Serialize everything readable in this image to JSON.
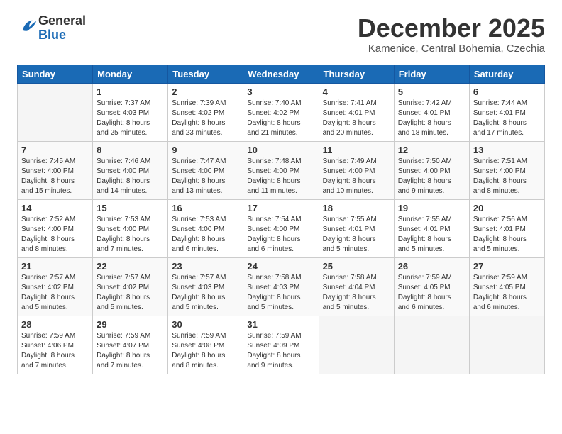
{
  "header": {
    "logo": {
      "general": "General",
      "blue": "Blue"
    },
    "title": "December 2025",
    "location": "Kamenice, Central Bohemia, Czechia"
  },
  "weekdays": [
    "Sunday",
    "Monday",
    "Tuesday",
    "Wednesday",
    "Thursday",
    "Friday",
    "Saturday"
  ],
  "weeks": [
    [
      {
        "day": "",
        "info": ""
      },
      {
        "day": "1",
        "info": "Sunrise: 7:37 AM\nSunset: 4:03 PM\nDaylight: 8 hours\nand 25 minutes."
      },
      {
        "day": "2",
        "info": "Sunrise: 7:39 AM\nSunset: 4:02 PM\nDaylight: 8 hours\nand 23 minutes."
      },
      {
        "day": "3",
        "info": "Sunrise: 7:40 AM\nSunset: 4:02 PM\nDaylight: 8 hours\nand 21 minutes."
      },
      {
        "day": "4",
        "info": "Sunrise: 7:41 AM\nSunset: 4:01 PM\nDaylight: 8 hours\nand 20 minutes."
      },
      {
        "day": "5",
        "info": "Sunrise: 7:42 AM\nSunset: 4:01 PM\nDaylight: 8 hours\nand 18 minutes."
      },
      {
        "day": "6",
        "info": "Sunrise: 7:44 AM\nSunset: 4:01 PM\nDaylight: 8 hours\nand 17 minutes."
      }
    ],
    [
      {
        "day": "7",
        "info": "Sunrise: 7:45 AM\nSunset: 4:00 PM\nDaylight: 8 hours\nand 15 minutes."
      },
      {
        "day": "8",
        "info": "Sunrise: 7:46 AM\nSunset: 4:00 PM\nDaylight: 8 hours\nand 14 minutes."
      },
      {
        "day": "9",
        "info": "Sunrise: 7:47 AM\nSunset: 4:00 PM\nDaylight: 8 hours\nand 13 minutes."
      },
      {
        "day": "10",
        "info": "Sunrise: 7:48 AM\nSunset: 4:00 PM\nDaylight: 8 hours\nand 11 minutes."
      },
      {
        "day": "11",
        "info": "Sunrise: 7:49 AM\nSunset: 4:00 PM\nDaylight: 8 hours\nand 10 minutes."
      },
      {
        "day": "12",
        "info": "Sunrise: 7:50 AM\nSunset: 4:00 PM\nDaylight: 8 hours\nand 9 minutes."
      },
      {
        "day": "13",
        "info": "Sunrise: 7:51 AM\nSunset: 4:00 PM\nDaylight: 8 hours\nand 8 minutes."
      }
    ],
    [
      {
        "day": "14",
        "info": "Sunrise: 7:52 AM\nSunset: 4:00 PM\nDaylight: 8 hours\nand 8 minutes."
      },
      {
        "day": "15",
        "info": "Sunrise: 7:53 AM\nSunset: 4:00 PM\nDaylight: 8 hours\nand 7 minutes."
      },
      {
        "day": "16",
        "info": "Sunrise: 7:53 AM\nSunset: 4:00 PM\nDaylight: 8 hours\nand 6 minutes."
      },
      {
        "day": "17",
        "info": "Sunrise: 7:54 AM\nSunset: 4:00 PM\nDaylight: 8 hours\nand 6 minutes."
      },
      {
        "day": "18",
        "info": "Sunrise: 7:55 AM\nSunset: 4:01 PM\nDaylight: 8 hours\nand 5 minutes."
      },
      {
        "day": "19",
        "info": "Sunrise: 7:55 AM\nSunset: 4:01 PM\nDaylight: 8 hours\nand 5 minutes."
      },
      {
        "day": "20",
        "info": "Sunrise: 7:56 AM\nSunset: 4:01 PM\nDaylight: 8 hours\nand 5 minutes."
      }
    ],
    [
      {
        "day": "21",
        "info": "Sunrise: 7:57 AM\nSunset: 4:02 PM\nDaylight: 8 hours\nand 5 minutes."
      },
      {
        "day": "22",
        "info": "Sunrise: 7:57 AM\nSunset: 4:02 PM\nDaylight: 8 hours\nand 5 minutes."
      },
      {
        "day": "23",
        "info": "Sunrise: 7:57 AM\nSunset: 4:03 PM\nDaylight: 8 hours\nand 5 minutes."
      },
      {
        "day": "24",
        "info": "Sunrise: 7:58 AM\nSunset: 4:03 PM\nDaylight: 8 hours\nand 5 minutes."
      },
      {
        "day": "25",
        "info": "Sunrise: 7:58 AM\nSunset: 4:04 PM\nDaylight: 8 hours\nand 5 minutes."
      },
      {
        "day": "26",
        "info": "Sunrise: 7:59 AM\nSunset: 4:05 PM\nDaylight: 8 hours\nand 6 minutes."
      },
      {
        "day": "27",
        "info": "Sunrise: 7:59 AM\nSunset: 4:05 PM\nDaylight: 8 hours\nand 6 minutes."
      }
    ],
    [
      {
        "day": "28",
        "info": "Sunrise: 7:59 AM\nSunset: 4:06 PM\nDaylight: 8 hours\nand 7 minutes."
      },
      {
        "day": "29",
        "info": "Sunrise: 7:59 AM\nSunset: 4:07 PM\nDaylight: 8 hours\nand 7 minutes."
      },
      {
        "day": "30",
        "info": "Sunrise: 7:59 AM\nSunset: 4:08 PM\nDaylight: 8 hours\nand 8 minutes."
      },
      {
        "day": "31",
        "info": "Sunrise: 7:59 AM\nSunset: 4:09 PM\nDaylight: 8 hours\nand 9 minutes."
      },
      {
        "day": "",
        "info": ""
      },
      {
        "day": "",
        "info": ""
      },
      {
        "day": "",
        "info": ""
      }
    ]
  ]
}
